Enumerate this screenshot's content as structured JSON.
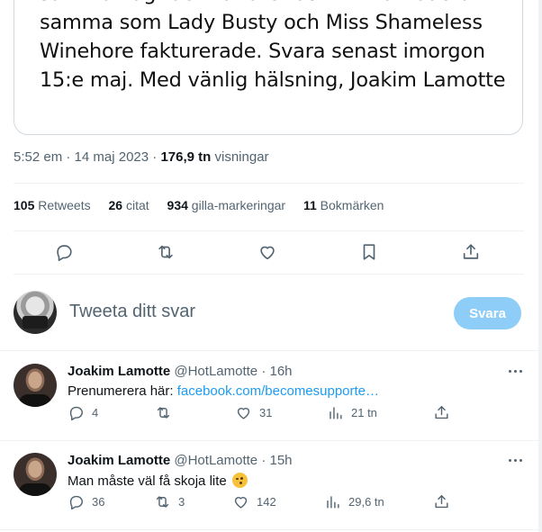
{
  "image_card": {
    "lines": [
      "sammanlagt det här året och mitt arvode blir",
      "samma som Lady Busty och Miss Shameless",
      "Winehore fakturerade. Svara senast imorgon",
      "15:e maj. Med vänlig hälsning, Joakim Lamotte"
    ]
  },
  "tweet_meta": {
    "time": "5:52 em",
    "sep1": "·",
    "date": "14 maj 2023",
    "sep2": "·",
    "views_count": "176,9 tn",
    "views_label": "visningar"
  },
  "stats": [
    {
      "count": "105",
      "label": "Retweets"
    },
    {
      "count": "26",
      "label": "citat"
    },
    {
      "count": "934",
      "label": "gilla-markeringar"
    },
    {
      "count": "11",
      "label": "Bokmärken"
    }
  ],
  "actions": {
    "icons": [
      "reply-icon",
      "retweet-icon",
      "like-icon",
      "bookmark-icon",
      "share-icon"
    ]
  },
  "compose": {
    "placeholder": "Tweeta ditt svar",
    "button": "Svara",
    "button_color": "#8ecdf7"
  },
  "replies": [
    {
      "name": "Joakim Lamotte",
      "handle": "@HotLamotte",
      "dot": "·",
      "time": "16h",
      "text_prefix": "Prenumerera här: ",
      "link": "facebook.com/becomesupporte…",
      "replies": "4",
      "retweets": "",
      "likes": "31",
      "views": "21 tn"
    },
    {
      "name": "Joakim Lamotte",
      "handle": "@HotLamotte",
      "dot": "·",
      "time": "15h",
      "text": "Man måste väl få skoja lite",
      "emoji": "winking-face",
      "replies": "36",
      "retweets": "3",
      "likes": "142",
      "views": "29,6 tn"
    }
  ],
  "colors": {
    "link": "#1d9bf0",
    "muted": "#536471",
    "text": "#0f1419",
    "border": "#eff3f4"
  }
}
